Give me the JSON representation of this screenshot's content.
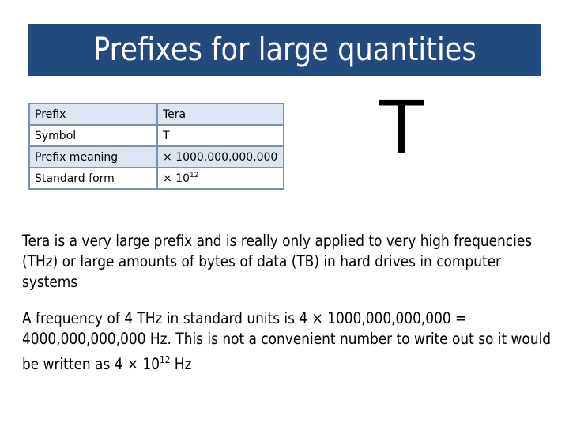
{
  "header": {
    "title": "Prefixes for large quantities"
  },
  "table": {
    "rows": [
      {
        "label": "Prefix",
        "value": "Tera"
      },
      {
        "label": "Symbol",
        "value": "T"
      },
      {
        "label": "Prefix meaning",
        "value": "× 1000,000,000,000"
      },
      {
        "label": "Standard form",
        "value_base": "× 10",
        "value_exp": "12"
      }
    ]
  },
  "symbol_display": "T",
  "paragraphs": {
    "p1": "Tera is a very large prefix and is really only applied to very high frequencies (THz) or large amounts of bytes of data (TB) in hard drives in computer systems",
    "p2_main": "A frequency of 4 THz in standard units is 4 × 1000,000,000,000 = 4000,000,000,000 Hz. This is not a convenient number to write out so it would be written as 4 × 10",
    "p2_exp": "12",
    "p2_tail": " Hz"
  },
  "colors": {
    "title_bg": "#234a7d",
    "table_shade": "#dce5f1",
    "table_border": "#7a91b0"
  }
}
